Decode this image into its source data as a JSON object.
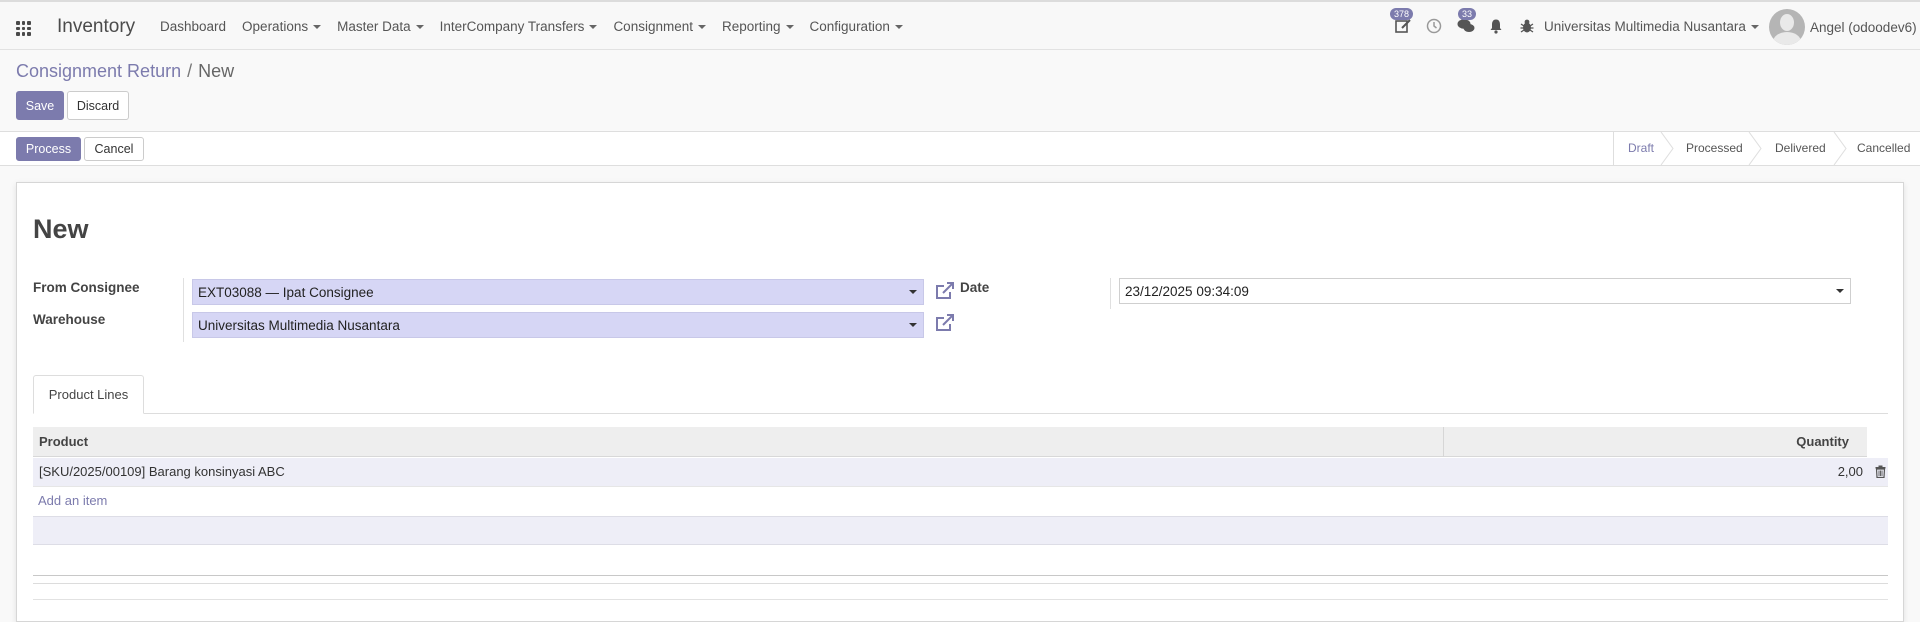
{
  "navbar": {
    "app_title": "Inventory",
    "menu": [
      {
        "label": "Dashboard",
        "dropdown": false
      },
      {
        "label": "Operations",
        "dropdown": true
      },
      {
        "label": "Master Data",
        "dropdown": true
      },
      {
        "label": "InterCompany Transfers",
        "dropdown": true
      },
      {
        "label": "Consignment",
        "dropdown": true
      },
      {
        "label": "Reporting",
        "dropdown": true
      },
      {
        "label": "Configuration",
        "dropdown": true
      }
    ],
    "activity_count": "378",
    "messages_count": "33",
    "company": "Universitas Multimedia Nusantara",
    "user": "Angel (odoodev6)",
    "accent_color": "#7c7bad"
  },
  "breadcrumb": {
    "parent": "Consignment Return",
    "current": "New"
  },
  "buttons": {
    "save": "Save",
    "discard": "Discard",
    "process": "Process",
    "cancel": "Cancel"
  },
  "statusbar": {
    "stages": [
      "Draft",
      "Processed",
      "Delivered",
      "Cancelled"
    ],
    "active": "Draft"
  },
  "form": {
    "title": "New",
    "from_consignee_label": "From Consignee",
    "from_consignee_value": "EXT03088 — Ipat Consignee",
    "warehouse_label": "Warehouse",
    "warehouse_value": "Universitas Multimedia Nusantara",
    "date_label": "Date",
    "date_value": "23/12/2025 09:34:09"
  },
  "tabs": [
    "Product Lines"
  ],
  "lines": {
    "headers": {
      "product": "Product",
      "quantity": "Quantity"
    },
    "rows": [
      {
        "product": "[SKU/2025/00109] Barang konsinyasi ABC",
        "quantity": "2,00"
      }
    ],
    "add_item": "Add an item"
  }
}
